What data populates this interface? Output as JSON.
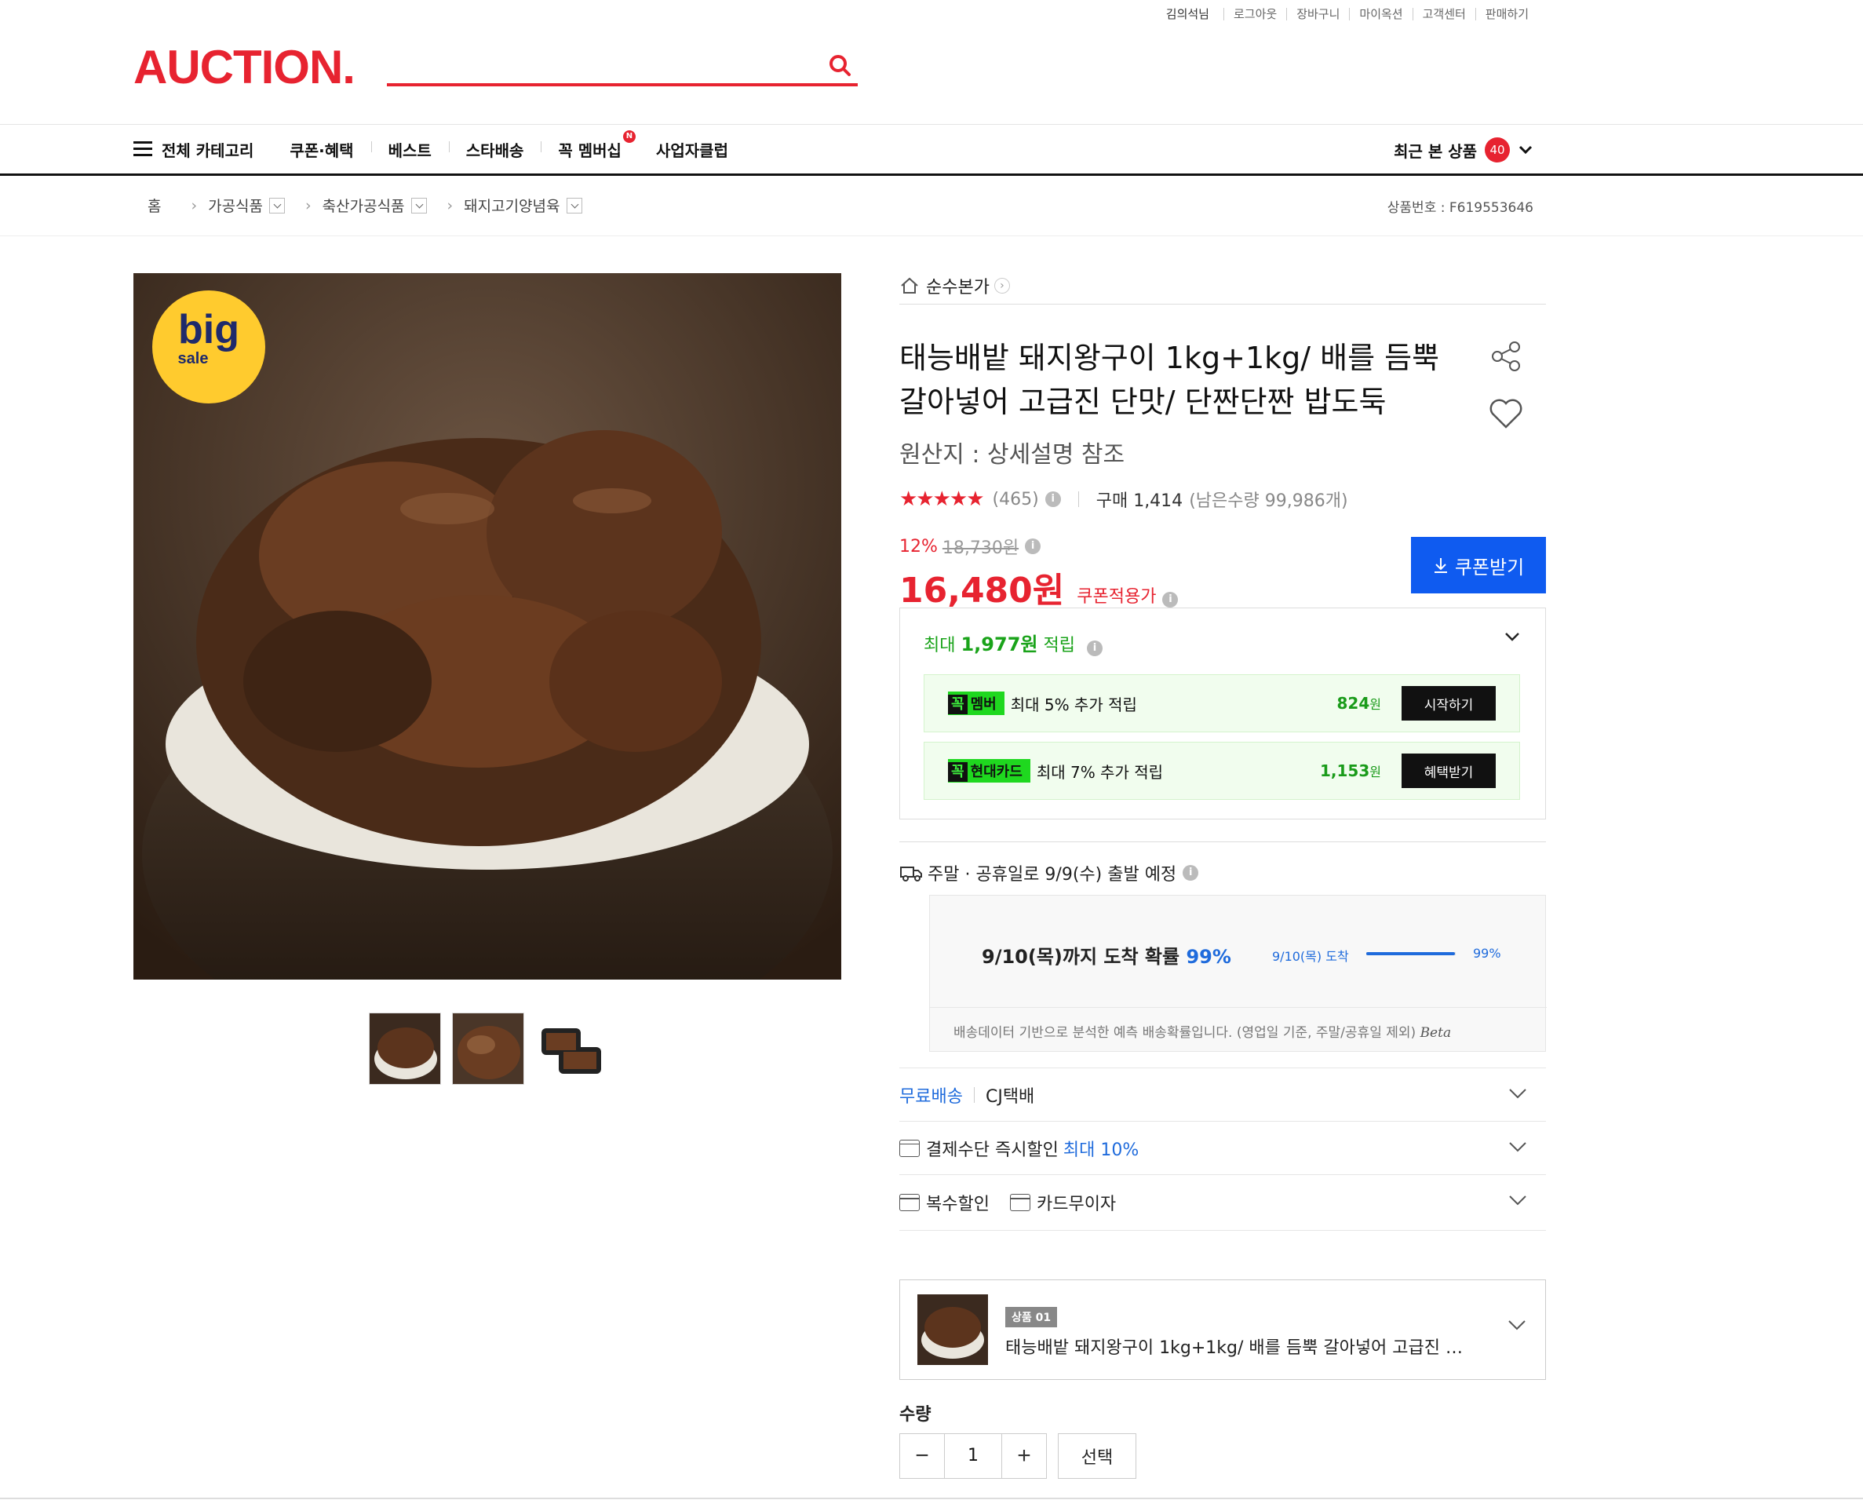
{
  "util": {
    "user": "김의석님",
    "links": [
      "로그아웃",
      "장바구니",
      "마이옥션",
      "고객센터",
      "판매하기"
    ]
  },
  "header": {
    "logo": "AUCTION.",
    "search_placeholder": ""
  },
  "nav": {
    "all_categories": "전체 카테고리",
    "items": [
      "쿠폰·혜택",
      "베스트",
      "스타배송",
      "꼭 멤버십",
      "사업자클럽"
    ],
    "membership_badge": "N",
    "recent_label": "최근 본 상품",
    "recent_count": "40"
  },
  "breadcrumb": {
    "home": "홈",
    "items": [
      "가공식품",
      "축산가공식품",
      "돼지고기양념육"
    ],
    "product_no": "상품번호 : F619553646"
  },
  "badge": {
    "line1": "big",
    "line2": "sale"
  },
  "product": {
    "store": "순수본가",
    "title": "태능배밭 돼지왕구이 1kg+1kg/ 배를 듬뿍 갈아넣어 고급진 단맛/ 단짠단짠 밥도둑",
    "origin": "원산지 : 상세설명 참조",
    "rating": 4.5,
    "stars": "★★★★★",
    "review_count": "(465)",
    "purchase": "구매 1,414",
    "remaining": "(남은수량 99,986개)",
    "discount": "12%",
    "original_price": "18,730원",
    "price": "16,480원",
    "price_note": "쿠폰적용가",
    "coupon_button": "쿠폰받기"
  },
  "reward": {
    "head_prefix": "최대 ",
    "head_amount": "1,977원",
    "head_suffix": " 적립",
    "rows": [
      {
        "brand_k": "꼭",
        "brand": "멤버",
        "desc": "최대 5% 추가 적립",
        "amount": "824",
        "unit": "원",
        "button": "시작하기"
      },
      {
        "brand_k": "꼭",
        "brand": "현대카드",
        "desc": "최대 7% 추가 적립",
        "amount": "1,153",
        "unit": "원",
        "button": "혜택받기"
      }
    ]
  },
  "shipping": {
    "notice": "주말 · 공휴일로 9/9(수) 출발 예정",
    "prob_main": "9/10(목)까지 도착 확률 ",
    "prob_pct": "99%",
    "prob_date": "9/10(목) 도착",
    "prob_value": 0.99,
    "prob_side_pct": "99%",
    "note": "배송데이터 기반으로 분석한 예측 배송확률입니다. (영업일 기준, 주말/공휴일 제외)",
    "beta": "Beta"
  },
  "options": {
    "free_ship": "무료배송",
    "carrier": "CJ택배",
    "payment_discount": "결제수단 즉시할인 ",
    "payment_max": "최대 10%",
    "multi_discount": "복수할인",
    "card_interest": "카드무이자"
  },
  "selected": {
    "tag": "상품 01",
    "name": "태능배밭 돼지왕구이 1kg+1kg/ 배를 듬뿍 갈아넣어 고급진 단..."
  },
  "quantity": {
    "label": "수량",
    "value": "1",
    "select": "선택"
  }
}
